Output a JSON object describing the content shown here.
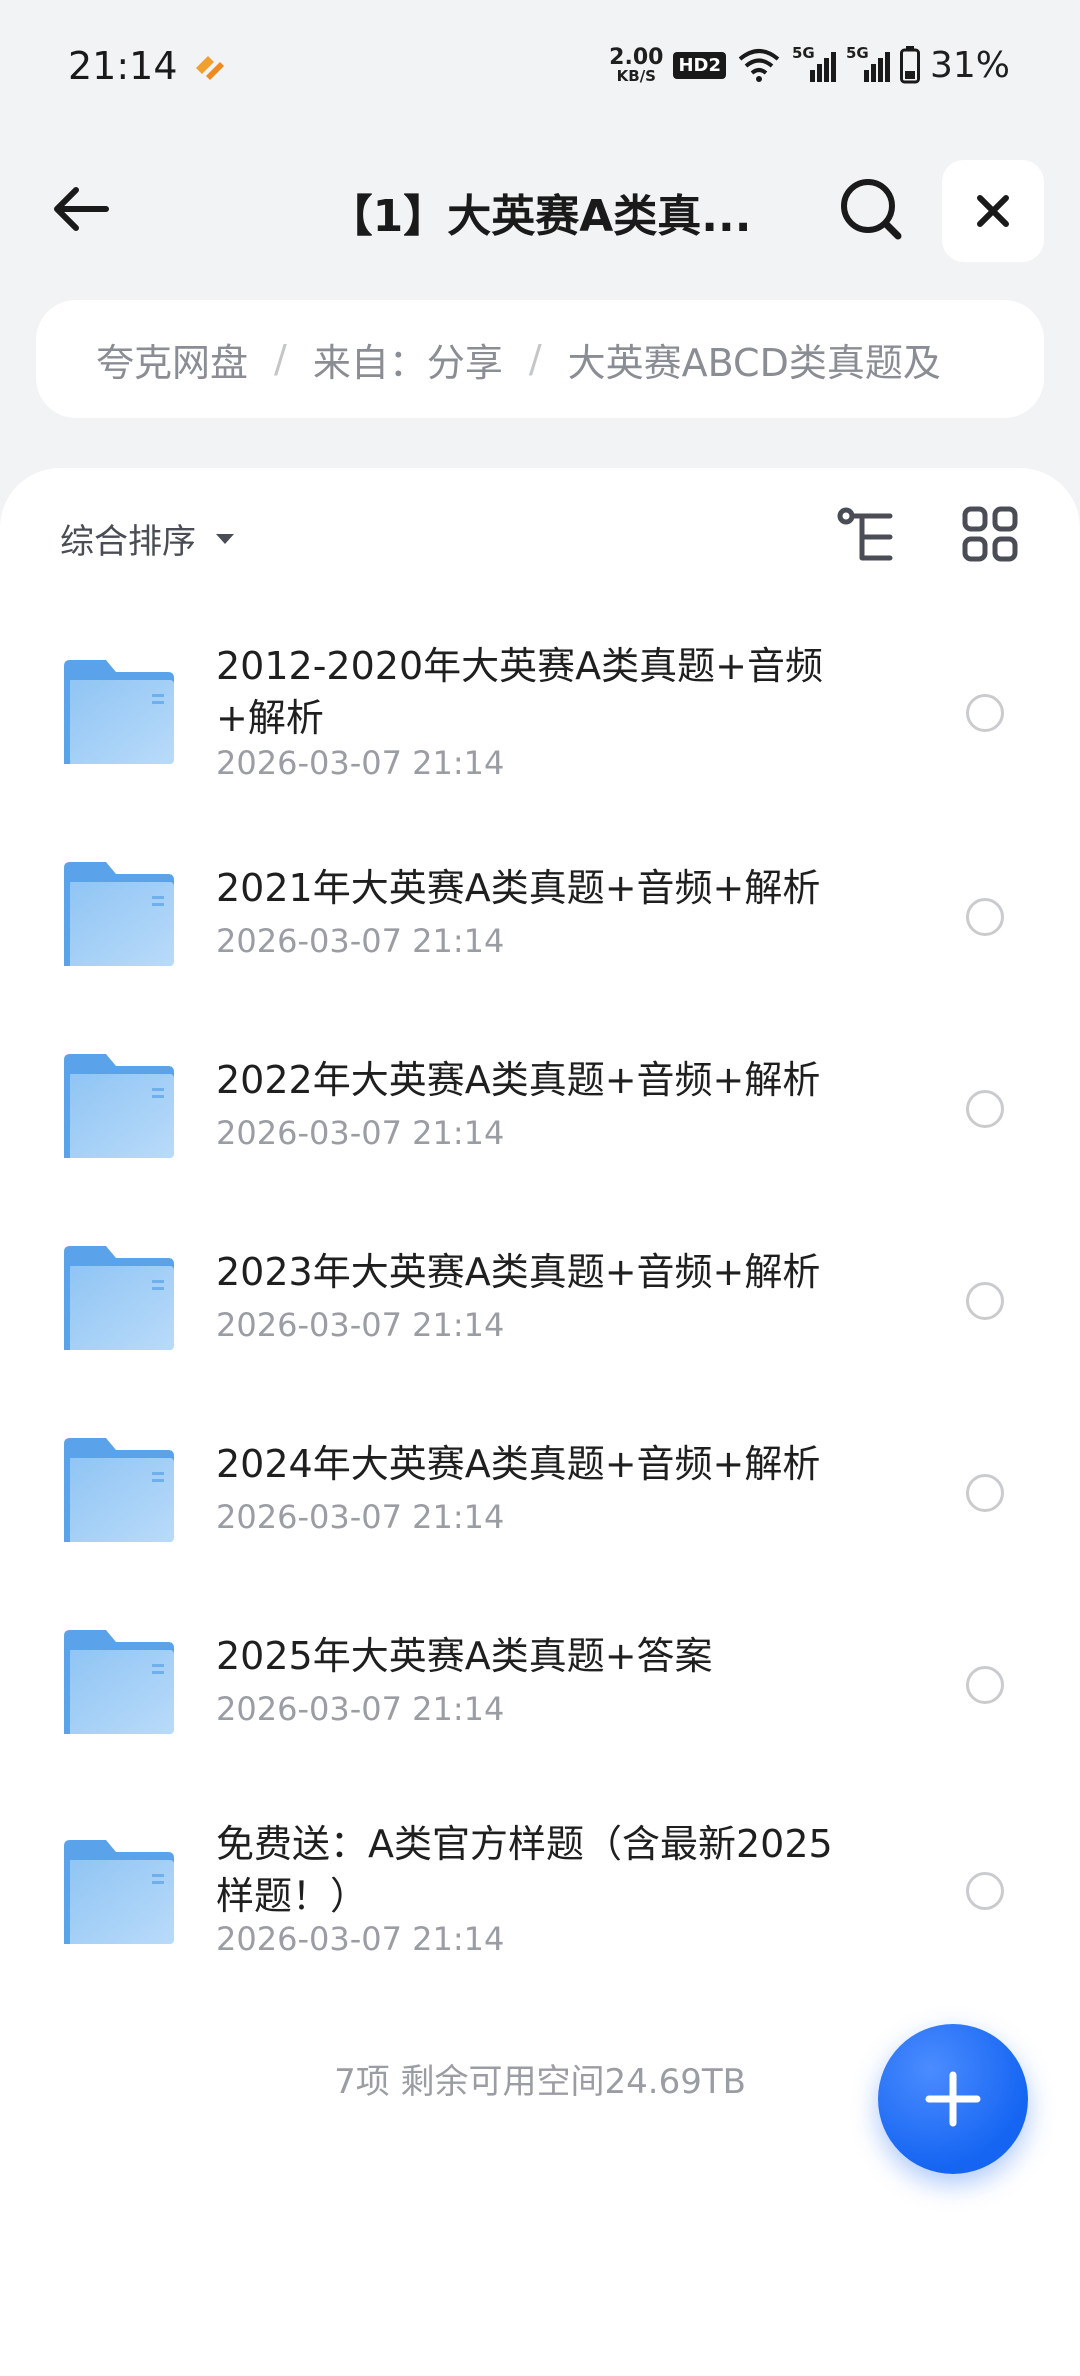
{
  "status_bar": {
    "time": "21:14",
    "net_speed_value": "2.00",
    "net_speed_unit": "KB/S",
    "hd_badge": "HD2",
    "sim1_label": "5G",
    "sim2_label": "5G",
    "battery_percent": "31%"
  },
  "header": {
    "title": "【1】大英赛A类真..."
  },
  "breadcrumb": [
    "夸克网盘",
    "来自：分享",
    "大英赛ABCD类真题及"
  ],
  "toolbar": {
    "sort_label": "综合排序"
  },
  "files": [
    {
      "name": "2012-2020年大英赛A类真题+音频+解析",
      "date": "2026-03-07 21:14"
    },
    {
      "name": "2021年大英赛A类真题+音频+解析",
      "date": "2026-03-07 21:14"
    },
    {
      "name": "2022年大英赛A类真题+音频+解析",
      "date": "2026-03-07 21:14"
    },
    {
      "name": "2023年大英赛A类真题+音频+解析",
      "date": "2026-03-07 21:14"
    },
    {
      "name": "2024年大英赛A类真题+音频+解析",
      "date": "2026-03-07 21:14"
    },
    {
      "name": "2025年大英赛A类真题+答案",
      "date": "2026-03-07 21:14"
    },
    {
      "name": "免费送：A类官方样题（含最新2025样题！）",
      "date": "2026-03-07 21:14"
    }
  ],
  "footer": {
    "summary": "7项 剩余可用空间24.69TB"
  },
  "colors": {
    "accent": "#1565f2",
    "folder": "#7db8ee"
  }
}
